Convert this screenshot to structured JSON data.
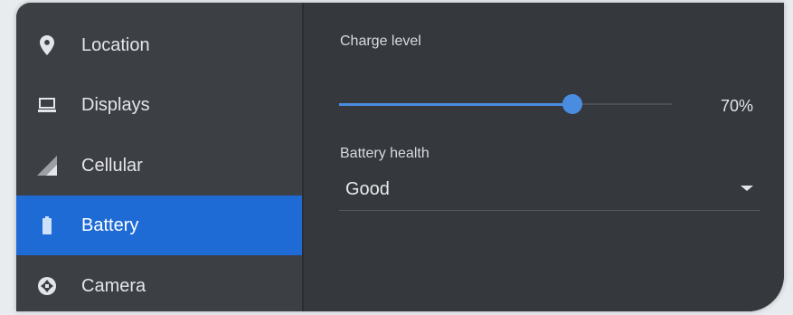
{
  "sidebar": {
    "items": [
      {
        "label": "Location",
        "icon": "location-pin-icon",
        "active": false
      },
      {
        "label": "Displays",
        "icon": "laptop-display-icon",
        "active": false
      },
      {
        "label": "Cellular",
        "icon": "cellular-signal-icon",
        "active": false
      },
      {
        "label": "Battery",
        "icon": "battery-icon",
        "active": true
      },
      {
        "label": "Camera",
        "icon": "camera-aperture-icon",
        "active": false
      }
    ]
  },
  "battery": {
    "charge_label": "Charge level",
    "charge_value": 70,
    "charge_display": "70%",
    "health_label": "Battery health",
    "health_value": "Good"
  },
  "colors": {
    "accent": "#1f6bd6",
    "slider": "#4a8de0",
    "sidebar_bg": "#3c3f44",
    "content_bg": "#35383c"
  }
}
